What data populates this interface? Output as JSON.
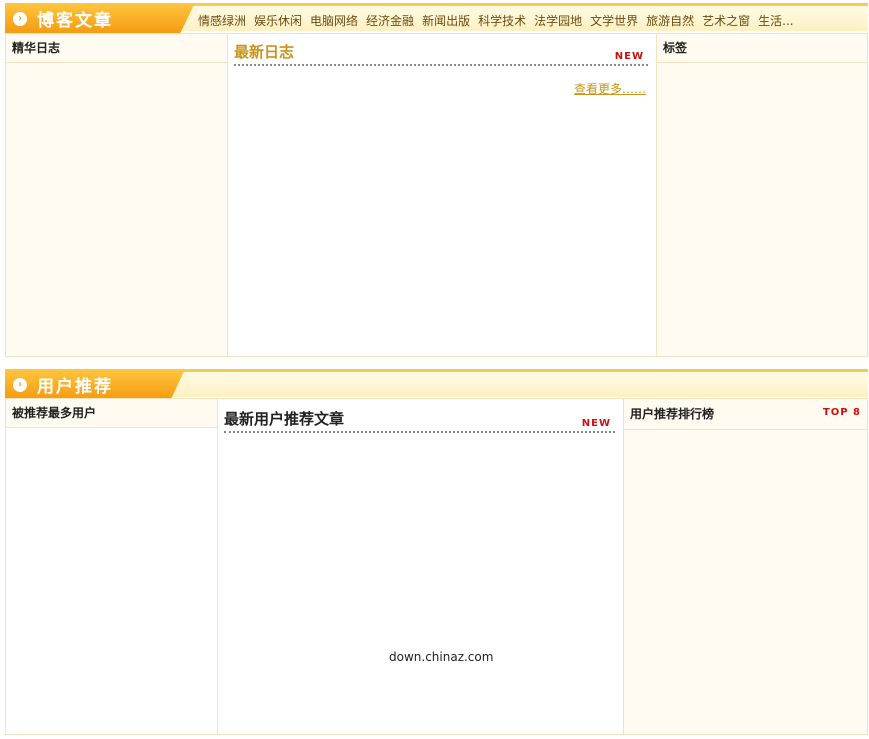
{
  "blog_section": {
    "title": "博客文章",
    "categories": [
      "情感绿洲",
      "娱乐休闲",
      "电脑网络",
      "经济金融",
      "新闻出版",
      "科学技术",
      "法学园地",
      "文学世界",
      "旅游自然",
      "艺术之窗",
      "生活..."
    ],
    "left_panel_title": "精华日志",
    "middle_title": "最新日志",
    "middle_badge": "NEW",
    "more_link": "查看更多……",
    "right_panel_title": "标签"
  },
  "recommend_section": {
    "title": "用户推荐",
    "left_panel_title": "被推荐最多用户",
    "middle_title": "最新用户推荐文章",
    "middle_badge": "NEW",
    "right_panel_title": "用户推荐排行榜",
    "right_badge": "TOP 8"
  },
  "watermark": "down.chinaz.com",
  "colors": {
    "accent": "#f59a10",
    "border": "#f5cd48",
    "badge": "#cc1010",
    "link": "#c8951c"
  }
}
